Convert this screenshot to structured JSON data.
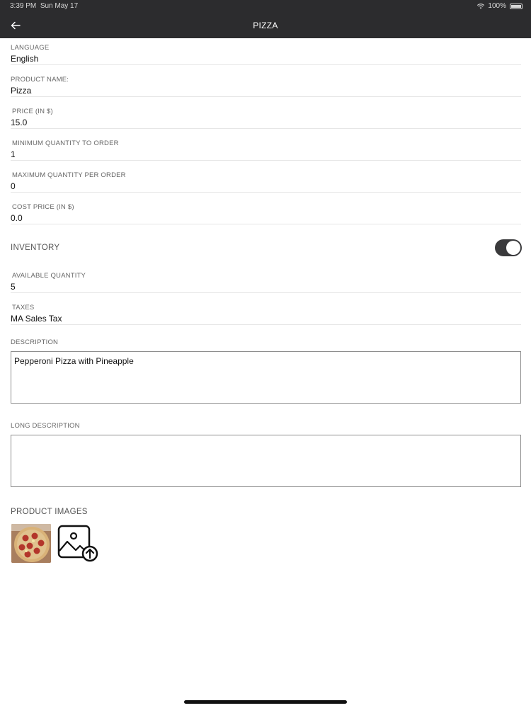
{
  "status_bar": {
    "time": "3:39 PM",
    "date": "Sun May 17",
    "battery": "100%",
    "wifi_icon": "wifi-icon",
    "battery_icon": "battery-icon"
  },
  "nav": {
    "title": "PIZZA",
    "back_icon": "arrow-left-icon"
  },
  "fields": {
    "language": {
      "label": "LANGUAGE",
      "value": "English"
    },
    "product_name": {
      "label": "PRODUCT NAME:",
      "value": "Pizza"
    },
    "price": {
      "label": "PRICE (IN $)",
      "value": "15.0"
    },
    "min_qty": {
      "label": "MINIMUM QUANTITY TO ORDER",
      "value": "1"
    },
    "max_qty": {
      "label": "MAXIMUM QUANTITY PER ORDER",
      "value": "0"
    },
    "cost_price": {
      "label": "COST PRICE (IN $)",
      "value": "0.0"
    },
    "available_qty": {
      "label": "AVAILABLE QUANTITY",
      "value": "5"
    },
    "taxes": {
      "label": "TAXES",
      "value": "MA Sales Tax"
    }
  },
  "inventory": {
    "label": "INVENTORY",
    "enabled": true
  },
  "description": {
    "label": "DESCRIPTION",
    "value": "Pepperoni Pizza with Pineapple"
  },
  "long_description": {
    "label": "LONG DESCRIPTION",
    "value": ""
  },
  "product_images": {
    "label": "PRODUCT IMAGES",
    "thumbnail_icon": "pizza-photo",
    "upload_icon": "image-upload-icon"
  },
  "colors": {
    "header_bg": "#2c2c2e",
    "toggle_on": "#3a3a3c",
    "divider": "#e6e6e6"
  }
}
